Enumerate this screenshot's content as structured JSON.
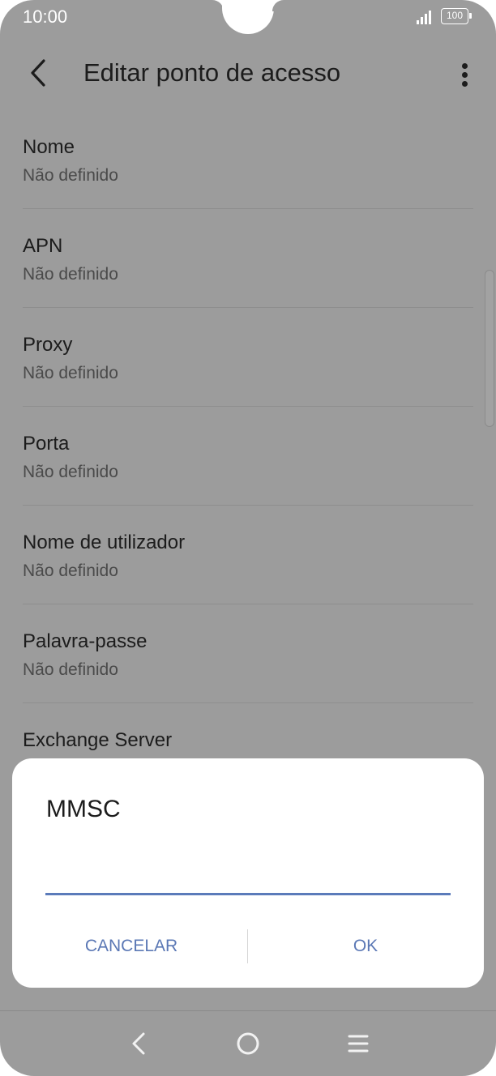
{
  "status_bar": {
    "time": "10:00",
    "battery": "100",
    "icons": [
      "signal-icon",
      "battery-icon"
    ]
  },
  "app_bar": {
    "title": "Editar ponto de acesso",
    "back_icon": "chevron-left-icon",
    "menu_icon": "more-vertical-icon"
  },
  "settings": {
    "items": [
      {
        "title": "Nome",
        "value": "Não definido"
      },
      {
        "title": "APN",
        "value": "Não definido"
      },
      {
        "title": "Proxy",
        "value": "Não definido"
      },
      {
        "title": "Porta",
        "value": "Não definido"
      },
      {
        "title": "Nome de utilizador",
        "value": "Não definido"
      },
      {
        "title": "Palavra-passe",
        "value": "Não definido"
      },
      {
        "title": "Exchange Server",
        "value": ""
      }
    ]
  },
  "dialog": {
    "title": "MMSC",
    "input_value": "",
    "cancel_label": "CANCELAR",
    "ok_label": "OK"
  },
  "nav_bar": {
    "icons": [
      "back-icon",
      "home-icon",
      "recents-icon"
    ]
  },
  "colors": {
    "overlay_background": "#9c9c9c",
    "accent": "#5b78b5",
    "dialog_background": "#ffffff"
  }
}
